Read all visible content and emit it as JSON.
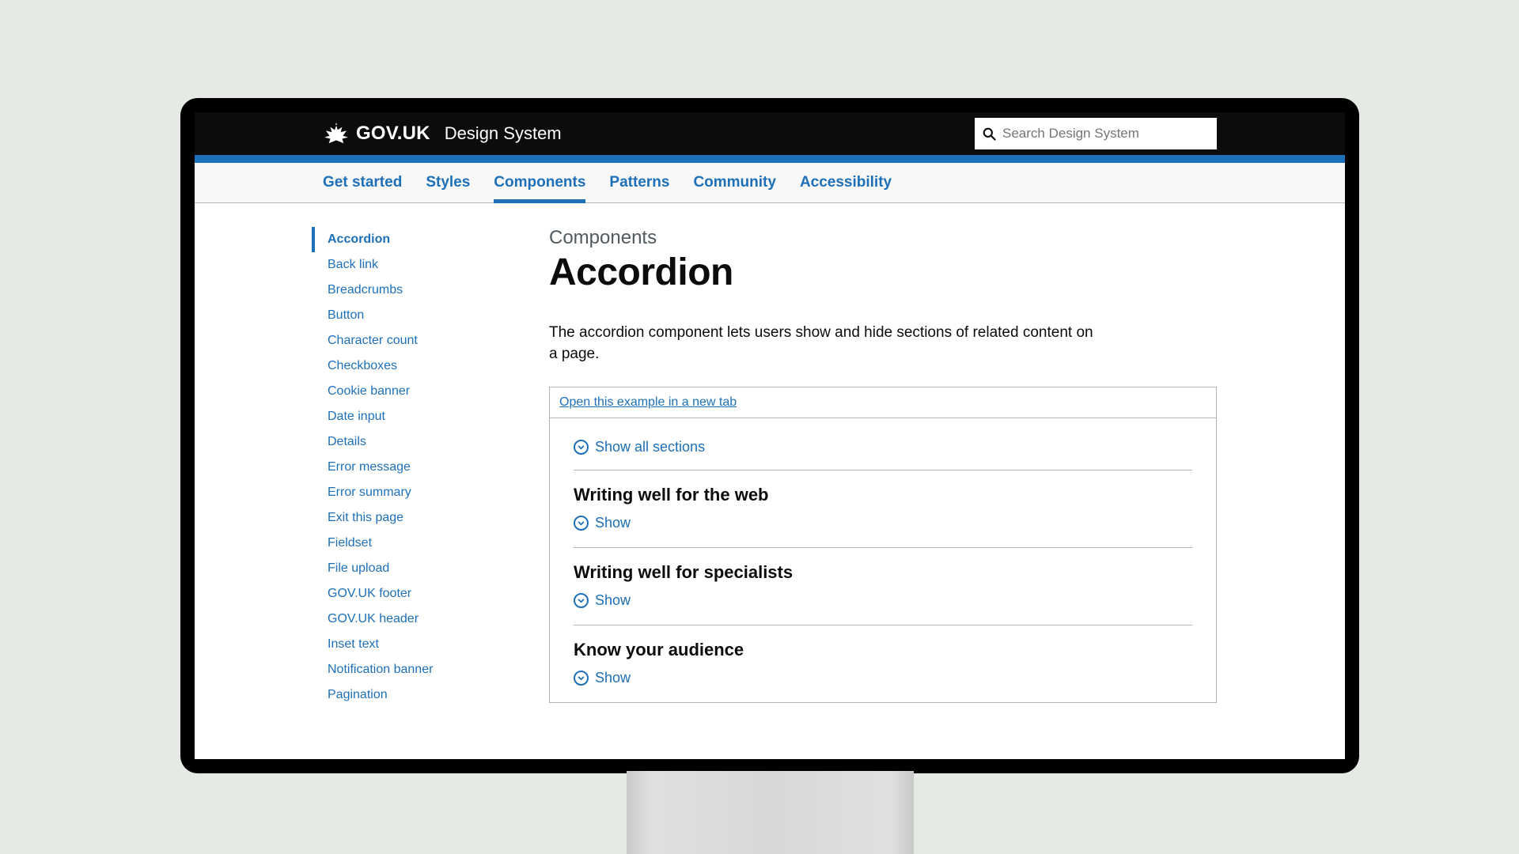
{
  "header": {
    "site_name": "GOV.UK",
    "product_name": "Design System",
    "search_placeholder": "Search Design System"
  },
  "nav": {
    "items": [
      "Get started",
      "Styles",
      "Components",
      "Patterns",
      "Community",
      "Accessibility"
    ],
    "active_index": 2
  },
  "sidebar": {
    "items": [
      "Accordion",
      "Back link",
      "Breadcrumbs",
      "Button",
      "Character count",
      "Checkboxes",
      "Cookie banner",
      "Date input",
      "Details",
      "Error message",
      "Error summary",
      "Exit this page",
      "Fieldset",
      "File upload",
      "GOV.UK footer",
      "GOV.UK header",
      "Inset text",
      "Notification banner",
      "Pagination"
    ],
    "active_index": 0
  },
  "main": {
    "section_label": "Components",
    "title": "Accordion",
    "intro": "The accordion component lets users show and hide sections of related content on a page.",
    "example_link": "Open this example in a new tab",
    "show_all": "Show all sections",
    "toggle_label": "Show",
    "accordion_sections": [
      "Writing well for the web",
      "Writing well for specialists",
      "Know your audience"
    ]
  }
}
